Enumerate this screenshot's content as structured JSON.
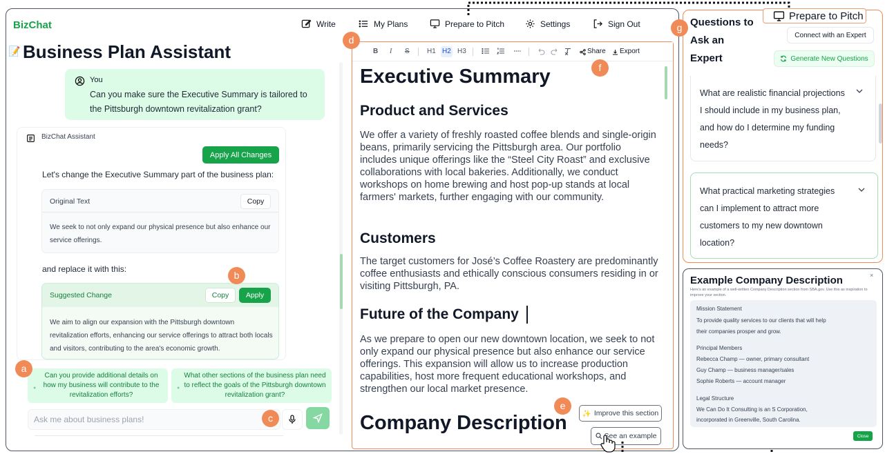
{
  "app": {
    "brand": "BizChat",
    "page_title": "Business Plan Assistant"
  },
  "nav": {
    "write": "Write",
    "my_plans": "My Plans",
    "prepare": "Prepare to Pitch",
    "settings": "Settings",
    "sign_out": "Sign Out"
  },
  "chat": {
    "user_name": "You",
    "user_message": "Can you make sure the Executive Summary is tailored to the Pittsburgh downtown revitalization grant?",
    "assistant_name": "BizChat Assistant",
    "apply_all": "Apply All Changes",
    "intro": "Let's change the Executive Summary part of the business plan:",
    "original_label": "Original Text",
    "copy": "Copy",
    "original_text": "We seek to not only expand our physical presence but also enhance our service offerings.",
    "replace_label": "and replace it with this:",
    "suggested_label": "Suggested Change",
    "apply": "Apply",
    "suggested_text": "We aim to align our expansion with the Pittsburgh downtown revitalization efforts, enhancing our service offerings to attract both locals and visitors, contributing to the area's economic growth.",
    "suggestions": [
      "Can you provide additional details on how my business will contribute to the revitalization efforts?",
      "What other sections of the business plan need to reflect the goals of the Pittsburgh downtown revitalization grant?"
    ],
    "input_placeholder": "Ask me about business plans!"
  },
  "editor": {
    "toolbar": {
      "bold": "B",
      "italic": "I",
      "strike": "S",
      "h1": "H1",
      "h2": "H2",
      "h3": "H3",
      "share": "Share",
      "export": "Export"
    },
    "h1": "Executive Summary",
    "sections": [
      {
        "heading": "Product and Services",
        "body": "We offer a variety of freshly roasted coffee blends and single-origin beans, primarily servicing the Pittsburgh area. Our portfolio includes unique offerings like the “Steel City Roast” and exclusive collaborations with local bakeries. Additionally, we conduct workshops on home brewing and host pop-up stands at local farmers' markets, further engaging with our community."
      },
      {
        "heading": "Customers",
        "body": "The target customers for José’s Coffee Roastery are predominantly coffee enthusiasts and ethically conscious consumers residing in or visiting Pittsburgh, PA."
      },
      {
        "heading": "Future of the Company",
        "body": "As we prepare to open our new downtown location, we seek to not only expand our physical presence but also enhance our service offerings. This expansion will allow us to increase production capabilities, host more frequent educational workshops, and strengthen our local market presence."
      }
    ],
    "h1_next": "Company Description",
    "improve": "Improve this section",
    "see_example": "See an example"
  },
  "questions": {
    "title": "Questions to Ask an Expert",
    "prepare_label": "Prepare to Pitch",
    "connect": "Connect with an Expert",
    "generate": "Generate New Questions",
    "items": [
      "What are realistic financial projections I should include in my business plan, and how do I determine my funding needs?",
      "What practical marketing strategies can I implement to attract more customers to my new downtown location?"
    ]
  },
  "example": {
    "title": "Example Company Description",
    "subtitle": "Here's an example of a well-written Company Description section from SBA.gov. Use this as inspiration to improve your section.",
    "close_x": "×",
    "lines": [
      "Mission Statement",
      "To provide quality services to our clients that will help",
      "their companies prosper and grow.",
      "Principal Members",
      "Rebecca Champ — owner, primary consultant",
      "Guy Champ — business manager/sales",
      "Sophie Roberts — account manager",
      "Legal Structure",
      "We Can Do It Consulting is an S Corporation,",
      "incorporated in Greenville, South Carolina."
    ],
    "close": "Close"
  },
  "markers": {
    "a": "a",
    "b": "b",
    "c": "c",
    "d": "d",
    "e": "e",
    "f": "f",
    "g": "g"
  },
  "icons": {
    "write": "pencil-square-icon",
    "my_plans": "list-icon",
    "prepare": "presentation-icon",
    "settings": "gear-icon",
    "sign_out": "sign-out-icon",
    "user": "user-circle-icon",
    "assistant": "chat-square-icon",
    "mic": "microphone-icon",
    "send": "send-icon",
    "share": "share-icon",
    "export": "download-icon",
    "generate": "refresh-icon",
    "improve": "sparkle-icon",
    "example": "magnifier-icon",
    "chevron": "chevron-down-icon"
  },
  "colors": {
    "brand": "#16a34a",
    "accent": "#f08b57",
    "chip": "#dcfce7"
  }
}
